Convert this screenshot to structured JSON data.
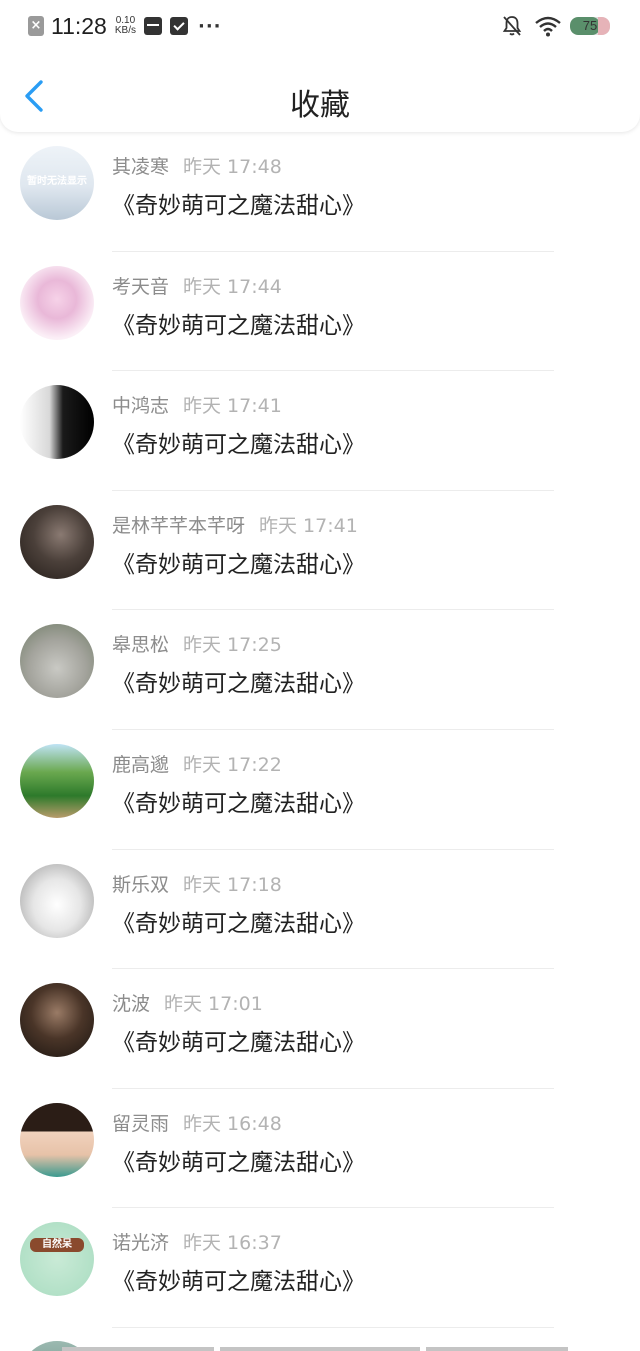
{
  "status_bar": {
    "time": "11:28",
    "net_speed_value": "0.10",
    "net_speed_unit": "KB/s",
    "battery": "75",
    "icons": [
      "close-notification-icon",
      "message-icon",
      "mail-icon",
      "more-dots-icon",
      "bell-muted-icon",
      "wifi-icon",
      "battery-icon"
    ]
  },
  "nav": {
    "title": "收藏",
    "back_icon": "chevron-left-icon",
    "accent_color": "#2a9df4"
  },
  "favorites": [
    {
      "name": "其凌寒",
      "time": "昨天 17:48",
      "post": "《奇妙萌可之魔法甜心》",
      "avatar_caption": "暂时无法显示"
    },
    {
      "name": "考天音",
      "time": "昨天 17:44",
      "post": "《奇妙萌可之魔法甜心》"
    },
    {
      "name": "中鸿志",
      "time": "昨天 17:41",
      "post": "《奇妙萌可之魔法甜心》"
    },
    {
      "name": "是林芊芊本芊呀",
      "time": "昨天 17:41",
      "post": "《奇妙萌可之魔法甜心》"
    },
    {
      "name": "皋思松",
      "time": "昨天 17:25",
      "post": "《奇妙萌可之魔法甜心》"
    },
    {
      "name": "鹿高邈",
      "time": "昨天 17:22",
      "post": "《奇妙萌可之魔法甜心》"
    },
    {
      "name": "斯乐双",
      "time": "昨天 17:18",
      "post": "《奇妙萌可之魔法甜心》"
    },
    {
      "name": "沈波",
      "time": "昨天 17:01",
      "post": "《奇妙萌可之魔法甜心》"
    },
    {
      "name": "留灵雨",
      "time": "昨天 16:48",
      "post": "《奇妙萌可之魔法甜心》"
    },
    {
      "name": "诺光济",
      "time": "昨天 16:37",
      "post": "《奇妙萌可之魔法甜心》",
      "avatar_caption": "自然呆"
    }
  ]
}
